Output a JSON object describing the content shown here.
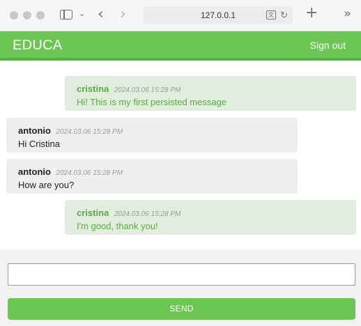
{
  "browser": {
    "url": "127.0.0.1",
    "icons": [
      "sidebar-icon",
      "chevron-down-icon",
      "back-icon",
      "forward-icon",
      "translate-icon",
      "reload-icon",
      "plus-icon",
      "more-icon"
    ]
  },
  "header": {
    "brand": "EDUCA",
    "signout_label": "Sign out",
    "color": "#6cc654"
  },
  "messages": [
    {
      "author": "cristina",
      "time": "2024.03.06 15:28 PM",
      "text": "Hi! This is my first persisted message",
      "self": true
    },
    {
      "author": "antonio",
      "time": "2024.03.06 15:28 PM",
      "text": "Hi Cristina",
      "self": false
    },
    {
      "author": "antonio",
      "time": "2024.03.06 15:28 PM",
      "text": "How are you?",
      "self": false
    },
    {
      "author": "cristina",
      "time": "2024.03.06 15:28 PM",
      "text": "I'm good, thank you!",
      "self": true
    }
  ],
  "composer": {
    "value": "",
    "send_label": "SEND"
  }
}
